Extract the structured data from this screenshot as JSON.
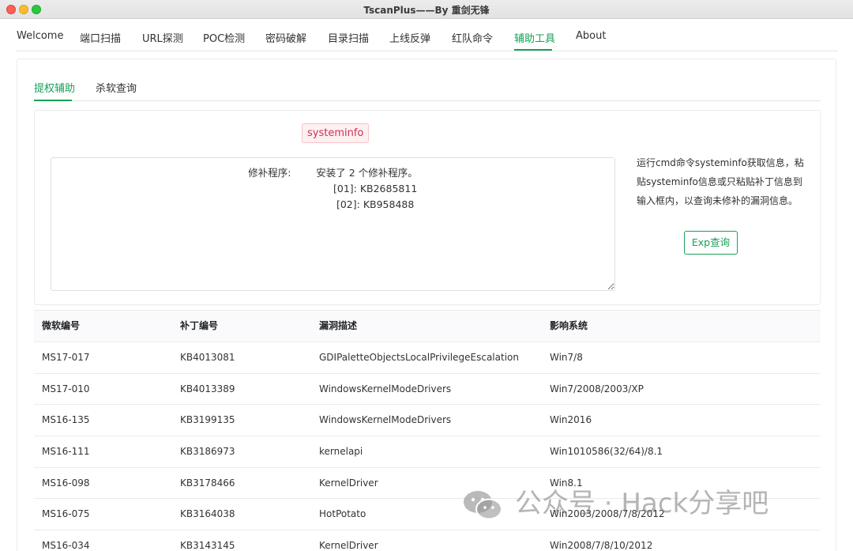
{
  "window": {
    "title": "TscanPlus——By 重剑无锋"
  },
  "nav": {
    "items": [
      "Welcome",
      "端口扫描",
      "URL探测",
      "POC检测",
      "密码破解",
      "目录扫描",
      "上线反弹",
      "红队命令",
      "辅助工具",
      "About"
    ],
    "active": "辅助工具"
  },
  "subtabs": {
    "items": [
      "提权辅助",
      "杀软查询"
    ],
    "active": "提权辅助"
  },
  "panel": {
    "command_tag": "systeminfo",
    "textarea_value": "修补程序:        安装了 2 个修补程序。\n                           [01]: KB2685811\n                           [02]: KB958488",
    "help_text": "运行cmd命令systeminfo获取信息，粘贴systeminfo信息或只粘贴补丁信息到输入框内，以查询未修补的漏洞信息。",
    "query_button": "Exp查询"
  },
  "table": {
    "columns": [
      "微软编号",
      "补丁编号",
      "漏洞描述",
      "影响系统"
    ],
    "rows": [
      [
        "MS17-017",
        "KB4013081",
        "GDIPaletteObjectsLocalPrivilegeEscalation",
        "Win7/8"
      ],
      [
        "MS17-010",
        "KB4013389",
        "WindowsKernelModeDrivers",
        "Win7/2008/2003/XP"
      ],
      [
        "MS16-135",
        "KB3199135",
        "WindowsKernelModeDrivers",
        "Win2016"
      ],
      [
        "MS16-111",
        "KB3186973",
        "kernelapi",
        "Win1010586(32/64)/8.1"
      ],
      [
        "MS16-098",
        "KB3178466",
        "KernelDriver",
        "Win8.1"
      ],
      [
        "MS16-075",
        "KB3164038",
        "HotPotato",
        "Win2003/2008/7/8/2012"
      ],
      [
        "MS16-034",
        "KB3143145",
        "KernelDriver",
        "Win2008/7/8/10/2012"
      ]
    ]
  },
  "watermark": {
    "text": "公众号 · Hack分享吧"
  },
  "colors": {
    "accent": "#18a058",
    "tag_red": "#d03050"
  }
}
